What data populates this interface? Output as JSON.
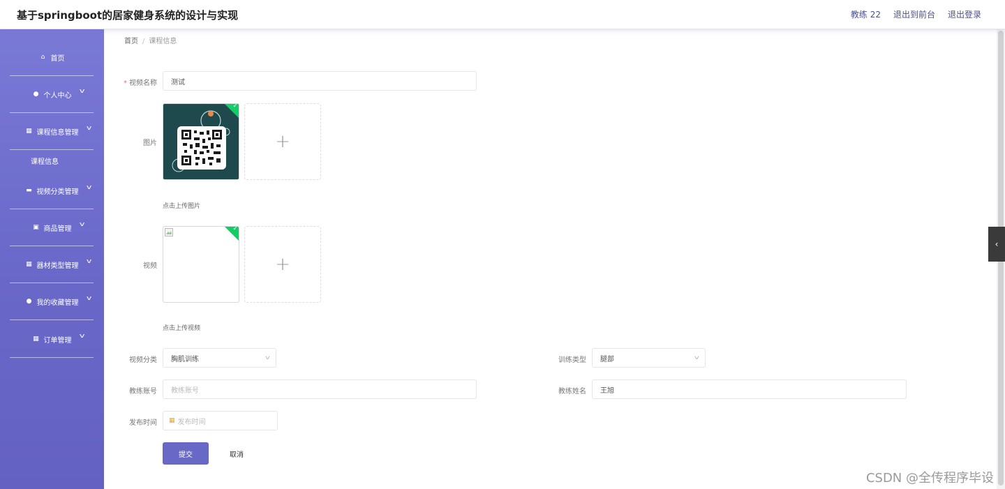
{
  "header": {
    "title": "基于springboot的居家健身系统的设计与实现",
    "user_label": "教练 22",
    "front_label": "退出到前台",
    "logout_label": "退出登录"
  },
  "sidebar": {
    "items": [
      {
        "label": "首页",
        "icon": "home-icon",
        "glyph": "⌂"
      },
      {
        "label": "个人中心",
        "icon": "user-icon",
        "glyph": "●"
      },
      {
        "label": "课程信息管理",
        "icon": "grid-icon",
        "glyph": "▦"
      },
      {
        "label": "视频分类管理",
        "icon": "ticket-icon",
        "glyph": "▬"
      },
      {
        "label": "商品管理",
        "icon": "chart-icon",
        "glyph": "▣"
      },
      {
        "label": "器材类型管理",
        "icon": "grid-icon",
        "glyph": "▦"
      },
      {
        "label": "我的收藏管理",
        "icon": "person-icon",
        "glyph": "●"
      },
      {
        "label": "订单管理",
        "icon": "grid-icon",
        "glyph": "▦"
      }
    ],
    "sub_item": "课程信息"
  },
  "breadcrumb": {
    "home": "首页",
    "sep": "/",
    "current": "课程信息"
  },
  "form": {
    "video_name": {
      "label": "视频名称",
      "required": "*",
      "value": "测试"
    },
    "image": {
      "label": "图片",
      "hint": "点击上传图片",
      "plus": "+"
    },
    "video": {
      "label": "视频",
      "hint": "点击上传视频",
      "plus": "+"
    },
    "video_category": {
      "label": "视频分类",
      "value": "胸肌训练"
    },
    "training_type": {
      "label": "训练类型",
      "value": "腿部"
    },
    "coach_account": {
      "label": "教练账号",
      "placeholder": "教练账号"
    },
    "coach_name": {
      "label": "教练姓名",
      "value": "王旭"
    },
    "publish_time": {
      "label": "发布时间",
      "placeholder": "发布时间"
    },
    "submit_label": "提交",
    "cancel_label": "取消"
  },
  "watermark": "CSDN @全传程序毕设"
}
